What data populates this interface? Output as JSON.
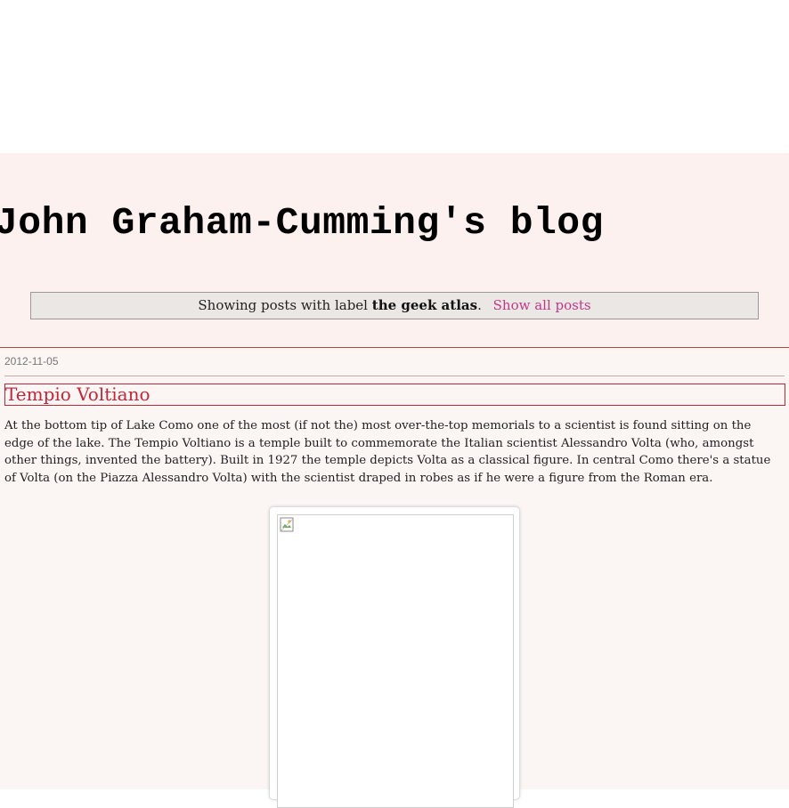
{
  "blog": {
    "title": "John Graham-Cumming's blog"
  },
  "label_bar": {
    "prefix": "Showing posts with label",
    "label": "the geek atlas",
    "suffix": ".",
    "show_all": "Show all posts"
  },
  "post": {
    "date": "2012-11-05",
    "title": "Tempio Voltiano",
    "body": "At the bottom tip of Lake Como one of the most (if not the) most over-the-top memorials to a scientist is found sitting on the edge of the lake. The Tempio Voltiano is a temple built to commemorate the Italian scientist Alessandro Volta (who, amongst other things, invented the battery). Built in 1927 the temple depicts Volta as a classical figure. In central Como there's a statue of Volta (on the Piazza Alessandro Volta) with the scientist draped in robes as if he were a figure from the Roman era.",
    "image_icon": "broken-image-icon"
  },
  "colors": {
    "header_bg": "#fcf1ef",
    "main_bg": "#fbf5f4",
    "link": "#c1388a",
    "title_accent": "#c1273a"
  }
}
